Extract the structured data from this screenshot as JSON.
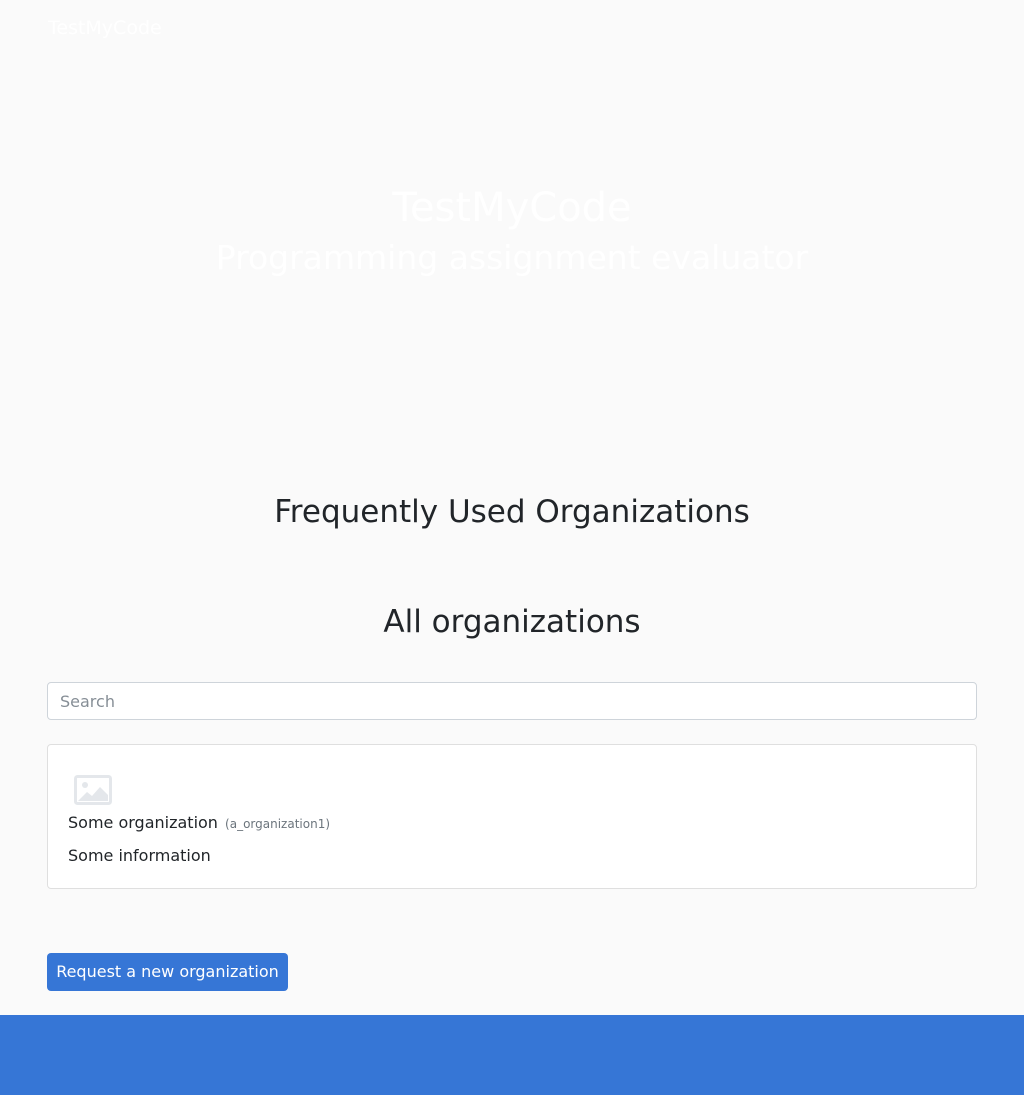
{
  "navbar": {
    "brand": "TestMyCode"
  },
  "hero": {
    "title": "TestMyCode",
    "subtitle": "Programming assignment evaluator"
  },
  "sections": {
    "frequent_heading": "Frequently Used Organizations",
    "all_heading": "All organizations"
  },
  "search": {
    "placeholder": "Search",
    "value": ""
  },
  "organizations": [
    {
      "logo_icon": "image-placeholder-icon",
      "name": "Some organization",
      "slug": "(a_organization1)",
      "information": "Some information"
    }
  ],
  "actions": {
    "request_label": "Request a new organization"
  },
  "colors": {
    "primary": "#3676d6",
    "background": "#fafafa",
    "card_border": "#dfdfdf",
    "hero_text": "#ffffff"
  }
}
